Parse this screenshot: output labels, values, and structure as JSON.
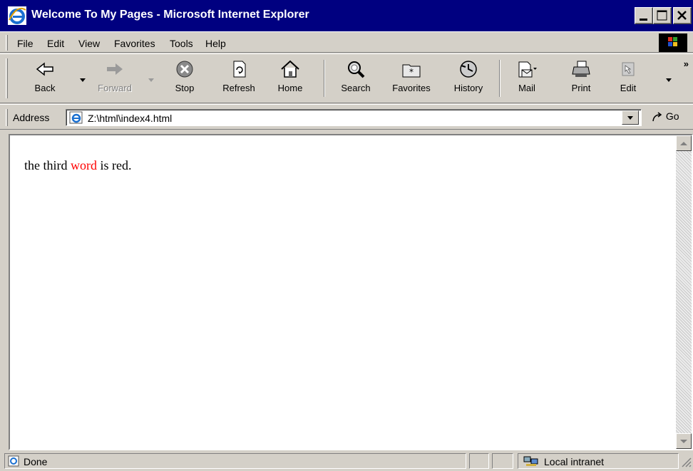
{
  "window": {
    "title": "Welcome To My Pages - Microsoft Internet Explorer",
    "title_bar_color": "#000080",
    "controls": [
      "minimize-icon",
      "maximize-icon",
      "close-icon"
    ]
  },
  "menu": {
    "items": [
      {
        "label": "File",
        "mnemonic": "F"
      },
      {
        "label": "Edit",
        "mnemonic": "E"
      },
      {
        "label": "View",
        "mnemonic": "V"
      },
      {
        "label": "Favorites",
        "mnemonic": "a"
      },
      {
        "label": "Tools",
        "mnemonic": "T"
      },
      {
        "label": "Help",
        "mnemonic": "H"
      }
    ]
  },
  "toolbar": {
    "buttons": [
      {
        "label": "Back",
        "icon": "back-arrow-icon",
        "enabled": true
      },
      {
        "label": "Forward",
        "icon": "forward-arrow-icon",
        "enabled": false
      },
      {
        "label": "Stop",
        "icon": "stop-icon",
        "enabled": true
      },
      {
        "label": "Refresh",
        "icon": "refresh-icon",
        "enabled": true
      },
      {
        "label": "Home",
        "icon": "home-icon",
        "enabled": true
      },
      {
        "label": "Search",
        "icon": "search-icon",
        "enabled": true
      },
      {
        "label": "Favorites",
        "icon": "favorites-icon",
        "enabled": true
      },
      {
        "label": "History",
        "icon": "history-icon",
        "enabled": true
      },
      {
        "label": "Mail",
        "icon": "mail-icon",
        "enabled": true
      },
      {
        "label": "Print",
        "icon": "print-icon",
        "enabled": true
      },
      {
        "label": "Edit",
        "icon": "edit-icon",
        "enabled": true
      }
    ],
    "overflow": "»"
  },
  "address": {
    "label": "Address",
    "url": "Z:\\html\\index4.html",
    "go_label": "Go"
  },
  "content": {
    "text_before": "the third ",
    "highlighted_word": "word",
    "text_after": " is red.",
    "highlight_color": "#ff0000"
  },
  "status": {
    "text": "Done",
    "zone": "Local intranet"
  }
}
